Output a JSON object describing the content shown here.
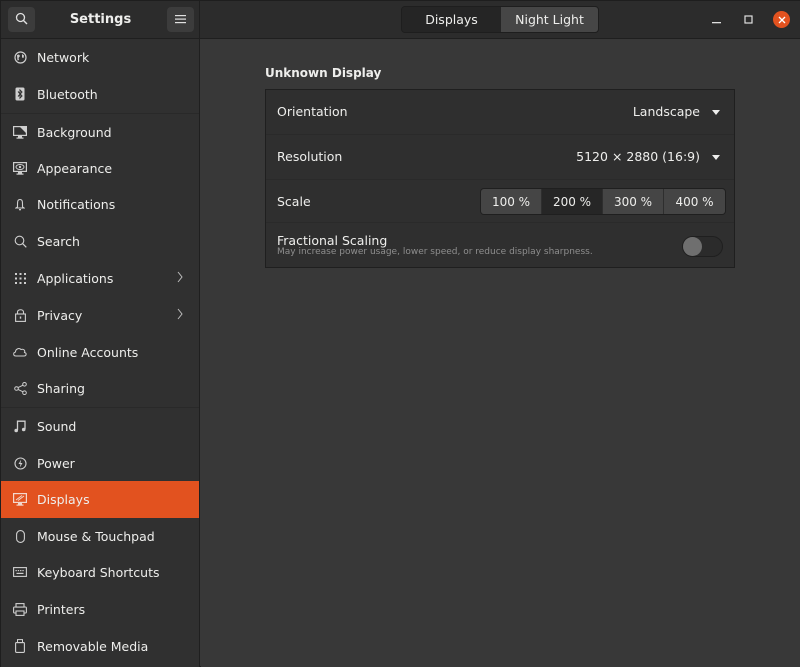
{
  "app": {
    "title": "Settings"
  },
  "header": {
    "search_icon": "search-icon",
    "menu_icon": "hamburger-menu-icon",
    "tabs": [
      {
        "label": "Displays",
        "selected": true
      },
      {
        "label": "Night Light",
        "selected": false
      }
    ],
    "window_controls": {
      "minimize": "minimize-icon",
      "maximize": "maximize-icon",
      "close": "close-icon"
    }
  },
  "sidebar": {
    "items": [
      {
        "label": "Network",
        "icon": "globe-icon"
      },
      {
        "label": "Bluetooth",
        "icon": "bluetooth-icon"
      },
      {
        "label": "Background",
        "icon": "background-icon"
      },
      {
        "label": "Appearance",
        "icon": "appearance-icon"
      },
      {
        "label": "Notifications",
        "icon": "bell-icon"
      },
      {
        "label": "Search",
        "icon": "search-icon"
      },
      {
        "label": "Applications",
        "icon": "grid-icon",
        "has_submenu": true
      },
      {
        "label": "Privacy",
        "icon": "lock-icon",
        "has_submenu": true
      },
      {
        "label": "Online Accounts",
        "icon": "cloud-icon"
      },
      {
        "label": "Sharing",
        "icon": "share-icon"
      },
      {
        "label": "Sound",
        "icon": "music-note-icon"
      },
      {
        "label": "Power",
        "icon": "power-icon"
      },
      {
        "label": "Displays",
        "icon": "display-icon",
        "active": true
      },
      {
        "label": "Mouse & Touchpad",
        "icon": "mouse-icon"
      },
      {
        "label": "Keyboard Shortcuts",
        "icon": "keyboard-icon"
      },
      {
        "label": "Printers",
        "icon": "printer-icon"
      },
      {
        "label": "Removable Media",
        "icon": "usb-drive-icon"
      }
    ]
  },
  "display": {
    "section_title": "Unknown Display",
    "orientation": {
      "label": "Orientation",
      "value": "Landscape"
    },
    "resolution": {
      "label": "Resolution",
      "value": "5120 × 2880 (16:9)"
    },
    "scale": {
      "label": "Scale",
      "options": [
        "100 %",
        "200 %",
        "300 %",
        "400 %"
      ],
      "selected": "200 %"
    },
    "fractional_scaling": {
      "label": "Fractional Scaling",
      "description": "May increase power usage, lower speed, or reduce display sharpness.",
      "enabled": false
    }
  },
  "colors": {
    "accent": "#e2521f",
    "sidebar_bg": "#303030",
    "content_bg": "#383838",
    "panel_bg": "#2f2f2f"
  }
}
